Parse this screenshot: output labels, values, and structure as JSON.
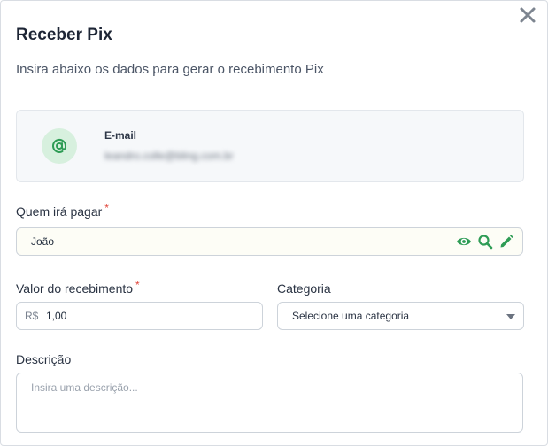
{
  "modal": {
    "title": "Receber Pix",
    "subtitle": "Insira abaixo os dados para gerar o recebimento Pix"
  },
  "key_card": {
    "icon": "at-sign-icon",
    "label": "E-mail",
    "value": "leandro.colle@bling.com.br"
  },
  "payer": {
    "label": "Quem irá pagar",
    "required_mark": "*",
    "value": "João",
    "icons": [
      "eye-icon",
      "search-icon",
      "pencil-icon"
    ]
  },
  "amount": {
    "label": "Valor do recebimento",
    "required_mark": "*",
    "currency": "R$",
    "value": "1,00"
  },
  "category": {
    "label": "Categoria",
    "selected": "Selecione uma categoria"
  },
  "description": {
    "label": "Descrição",
    "placeholder": "Insira uma descrição..."
  },
  "colors": {
    "accent_green": "#2e9c55",
    "required_red": "#e0463b"
  }
}
